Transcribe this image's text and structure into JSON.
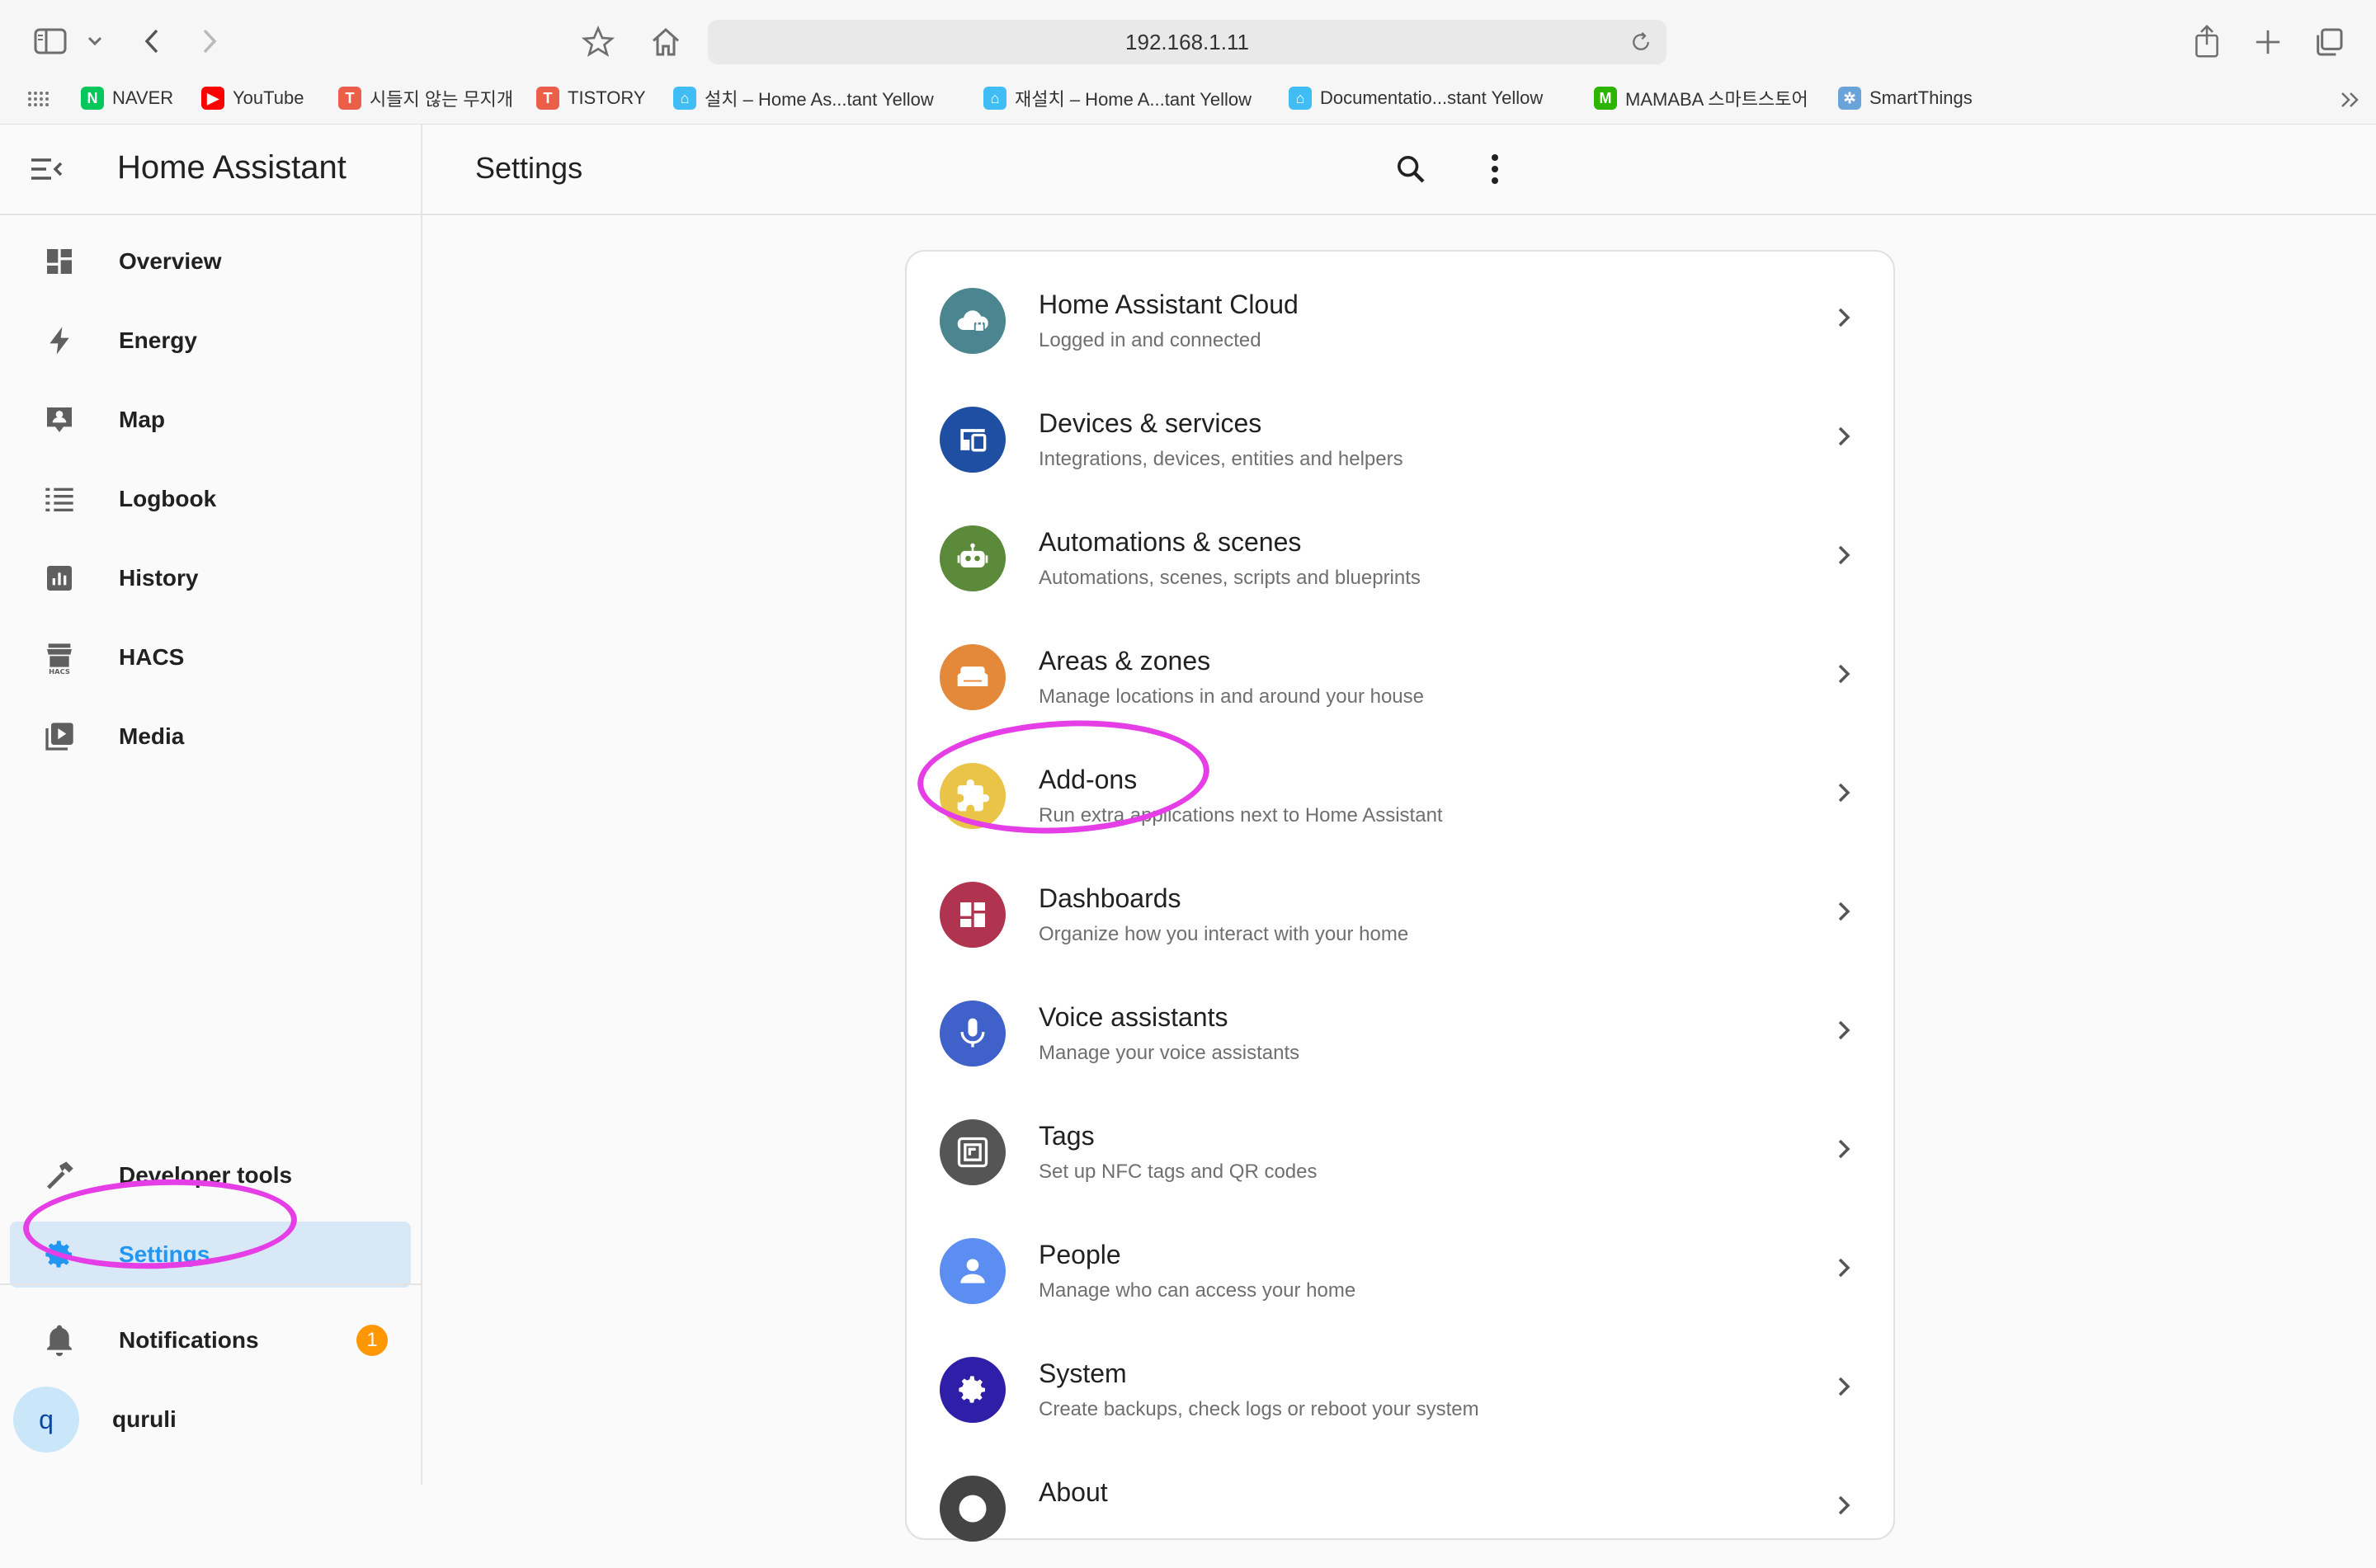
{
  "browser": {
    "url": "192.168.1.11",
    "bookmarks": [
      {
        "label": "NAVER",
        "fav": "N",
        "color": "#03c75a"
      },
      {
        "label": "YouTube",
        "fav": "▶",
        "color": "#ff0000"
      },
      {
        "label": "시들지 않는 무지개",
        "fav": "T",
        "color": "#eb5e4a"
      },
      {
        "label": "TISTORY",
        "fav": "T",
        "color": "#eb5e4a"
      },
      {
        "label": "설치 – Home As...tant Yellow",
        "fav": "⌂",
        "color": "#41bdf5"
      },
      {
        "label": "재설치 – Home A...tant Yellow",
        "fav": "⌂",
        "color": "#41bdf5"
      },
      {
        "label": "Documentatio...stant Yellow",
        "fav": "⌂",
        "color": "#41bdf5"
      },
      {
        "label": "MAMABA 스마트스토어",
        "fav": "M",
        "color": "#2db400"
      },
      {
        "label": "SmartThings",
        "fav": "✲",
        "color": "#6aa3d8"
      }
    ]
  },
  "sidebar": {
    "title": "Home Assistant",
    "items": [
      {
        "label": "Overview",
        "icon": "dashboard-icon"
      },
      {
        "label": "Energy",
        "icon": "lightning-icon"
      },
      {
        "label": "Map",
        "icon": "map-icon"
      },
      {
        "label": "Logbook",
        "icon": "list-icon"
      },
      {
        "label": "History",
        "icon": "chart-icon"
      },
      {
        "label": "HACS",
        "icon": "hacs-icon"
      },
      {
        "label": "Media",
        "icon": "media-icon"
      }
    ],
    "bottom_items": [
      {
        "label": "Developer tools",
        "icon": "hammer-icon"
      },
      {
        "label": "Settings",
        "icon": "gear-icon"
      }
    ],
    "notifications": {
      "label": "Notifications",
      "count": "1"
    },
    "user": {
      "initial": "q",
      "name": "quruli"
    }
  },
  "header": {
    "title": "Settings"
  },
  "settings": [
    {
      "title": "Home Assistant Cloud",
      "subtitle": "Logged in and connected",
      "color": "#4a8590",
      "icon": "cloud-lock-icon"
    },
    {
      "title": "Devices & services",
      "subtitle": "Integrations, devices, entities and helpers",
      "color": "#1e4fa3",
      "icon": "devices-icon"
    },
    {
      "title": "Automations & scenes",
      "subtitle": "Automations, scenes, scripts and blueprints",
      "color": "#5b8a3a",
      "icon": "robot-icon"
    },
    {
      "title": "Areas & zones",
      "subtitle": "Manage locations in and around your house",
      "color": "#e4893a",
      "icon": "sofa-icon"
    },
    {
      "title": "Add-ons",
      "subtitle": "Run extra applications next to Home Assistant",
      "color": "#e9c447",
      "icon": "puzzle-icon"
    },
    {
      "title": "Dashboards",
      "subtitle": "Organize how you interact with your home",
      "color": "#b0344f",
      "icon": "dashboard-icon"
    },
    {
      "title": "Voice assistants",
      "subtitle": "Manage your voice assistants",
      "color": "#3f61c9",
      "icon": "microphone-icon"
    },
    {
      "title": "Tags",
      "subtitle": "Set up NFC tags and QR codes",
      "color": "#555555",
      "icon": "tag-nfc-icon"
    },
    {
      "title": "People",
      "subtitle": "Manage who can access your home",
      "color": "#5c8ef2",
      "icon": "person-icon"
    },
    {
      "title": "System",
      "subtitle": "Create backups, check logs or reboot your system",
      "color": "#2f1fa8",
      "icon": "gear-icon"
    },
    {
      "title": "About",
      "subtitle": "",
      "color": "#444444",
      "icon": "info-icon"
    }
  ],
  "annotation_color": "#e63ee6"
}
